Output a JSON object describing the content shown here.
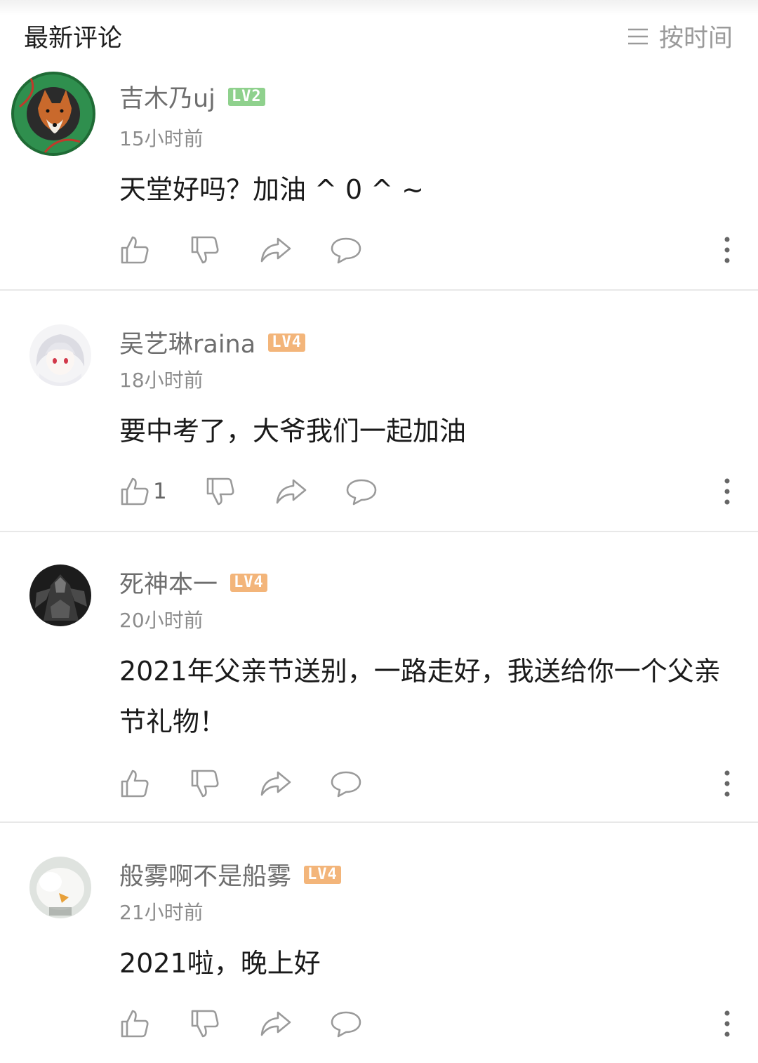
{
  "header": {
    "title": "最新评论",
    "sort_label": "按时间",
    "sort_icon": "list-lines-icon"
  },
  "colors": {
    "lv2_badge": "#8fd18d",
    "lv4_badge": "#f3b57a",
    "icon_gray": "#9a9a9a",
    "divider": "#e8e8e8"
  },
  "comments": [
    {
      "name": "吉木乃uj",
      "level": "LV2",
      "time": "15小时前",
      "text": "天堂好吗？加油 ^ 0 ^ ~",
      "like_count": "",
      "avatar": "fox-wreath-avatar"
    },
    {
      "name": "吴艺琳raina",
      "level": "LV4",
      "time": "18小时前",
      "text": "要中考了，大爷我们一起加油",
      "like_count": "1",
      "avatar": "anime-girl-avatar"
    },
    {
      "name": "死神本一",
      "level": "LV4",
      "time": "20小时前",
      "text": "2021年父亲节送别，一路走好，我送给你一个父亲节礼物！",
      "like_count": "",
      "avatar": "dark-figure-avatar"
    },
    {
      "name": "般雾啊不是船雾",
      "level": "LV4",
      "time": "21小时前",
      "text": "2021啦，晚上好",
      "like_count": "",
      "avatar": "white-bird-avatar"
    }
  ]
}
